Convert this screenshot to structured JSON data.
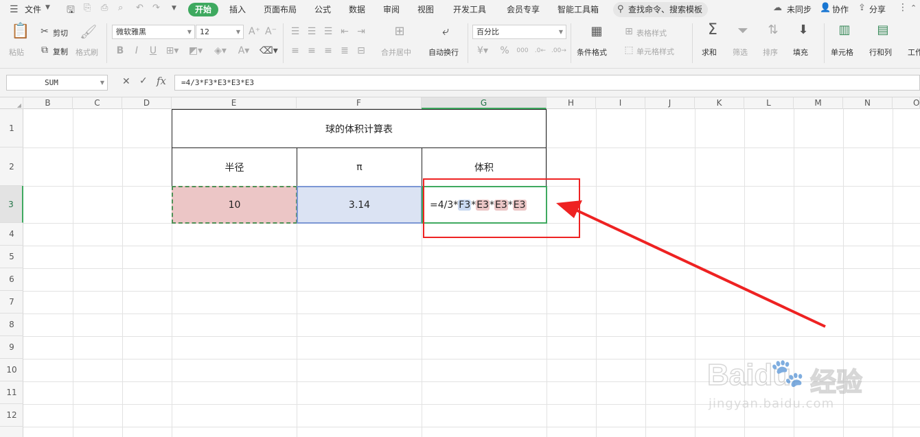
{
  "menu": {
    "file_label": "文件",
    "tabs": [
      "开始",
      "插入",
      "页面布局",
      "公式",
      "数据",
      "审阅",
      "视图",
      "开发工具",
      "会员专享",
      "智能工具箱"
    ],
    "search_placeholder": "查找命令、搜索模板",
    "sync_label": "未同步",
    "collab_label": "协作",
    "share_label": "分享"
  },
  "ribbon": {
    "paste": "粘贴",
    "cut": "剪切",
    "copy": "复制",
    "format_painter": "格式刷",
    "font_name": "微软雅黑",
    "font_size": "12",
    "merge_center": "合并居中",
    "wrap_text": "自动换行",
    "number_format": "百分比",
    "conditional_format": "条件格式",
    "table_style": "表格样式",
    "cell_style": "单元格样式",
    "sum": "求和",
    "filter": "筛选",
    "sort": "排序",
    "fill": "填充",
    "cells": "单元格",
    "rows_cols": "行和列",
    "worksheet": "工作"
  },
  "formula_bar": {
    "name_box": "SUM",
    "formula": "=4/3*F3*E3*E3*E3"
  },
  "columns": [
    "B",
    "C",
    "D",
    "E",
    "F",
    "G",
    "H",
    "I",
    "J",
    "K",
    "L",
    "M",
    "N",
    "O"
  ],
  "rows": [
    "1",
    "2",
    "3",
    "4",
    "5",
    "6",
    "7",
    "8",
    "9",
    "10",
    "11",
    "12"
  ],
  "sheet": {
    "title": "球的体积计算表",
    "headers": [
      "半径",
      "π",
      "体积"
    ],
    "values": {
      "radius": "10",
      "pi": "3.14"
    },
    "formula_parts": {
      "prefix": "=4/3*",
      "ref1": "F3",
      "op1": "*",
      "ref2": "E3",
      "op2": "*",
      "ref3": "E3",
      "op3": "*",
      "ref4": "E3"
    }
  },
  "watermark": {
    "brand": "Baidu",
    "brand_cn": "经验",
    "url": "jingyan.baidu.com"
  },
  "colors": {
    "accent": "#3ea95f",
    "annotation": "#ee2222",
    "ref_blue": "#c9d9f1",
    "ref_red": "#ecc6c6"
  }
}
